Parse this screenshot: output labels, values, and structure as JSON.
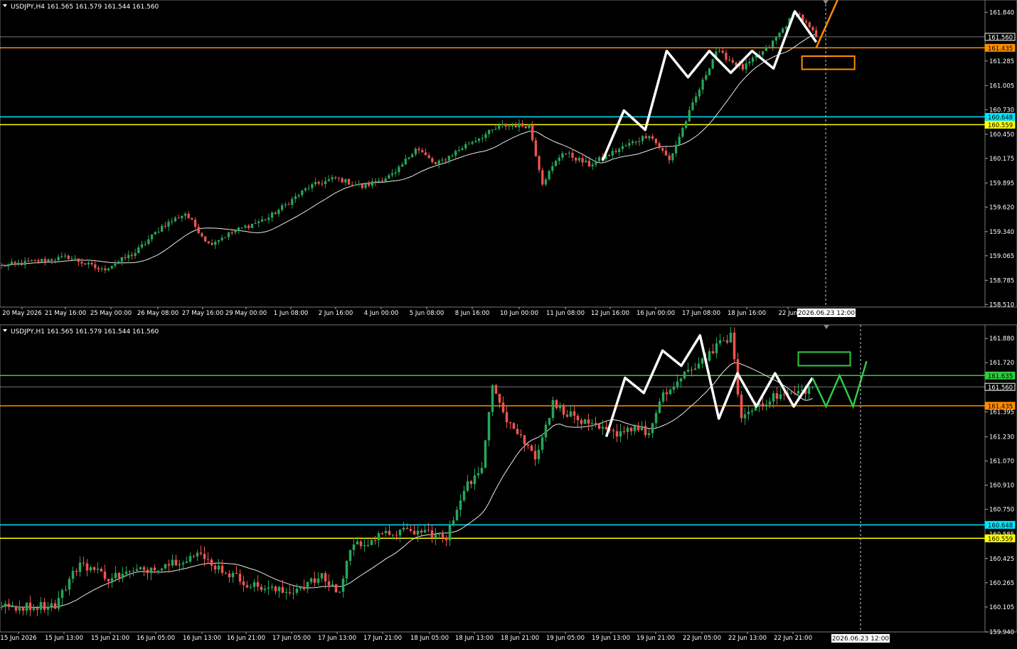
{
  "panels": [
    {
      "id": "h4",
      "header": "USDJPY,H4  161.565 161.579 161.544 161.560",
      "ticks": [
        "161.840",
        "161.285",
        "161.005",
        "160.730",
        "160.450",
        "160.175",
        "159.895",
        "159.620",
        "159.340",
        "159.065",
        "158.785",
        "158.510"
      ],
      "price_labels": [
        {
          "text": "161.560",
          "bg": "#000000",
          "fg": "#ffffff"
        },
        {
          "text": "161.435",
          "bg": "#ff8c00",
          "fg": "#000000"
        },
        {
          "text": "160.648",
          "bg": "#00e5ff",
          "fg": "#000000"
        },
        {
          "text": "160.559",
          "bg": "#ffff00",
          "fg": "#000000"
        }
      ],
      "time_labels": [
        "20 May 2026",
        "21 May 16:00",
        "25 May 00:00",
        "26 May 08:00",
        "27 May 16:00",
        "29 May 00:00",
        "1 Jun 08:00",
        "2 Jun 16:00",
        "4 Jun 00:00",
        "5 Jun 08:00",
        "8 Jun 16:00",
        "10 Jun 00:00",
        "11 Jun 08:00",
        "12 Jun 16:00",
        "16 Jun 00:00",
        "17 Jun 08:00",
        "18 Jun 16:00",
        "22 Jun"
      ],
      "cursor_label": "2026.06.23 12:00"
    },
    {
      "id": "h1",
      "header": "USDJPY,H1  161.565 161.579 161.544 161.560",
      "ticks": [
        "161.880",
        "161.720",
        "161.395",
        "161.230",
        "161.070",
        "160.910",
        "160.750",
        "160.425",
        "160.265",
        "160.105",
        "159.940"
      ],
      "price_labels": [
        {
          "text": "161.635",
          "bg": "#2ecc40",
          "fg": "#000000"
        },
        {
          "text": "161.560",
          "bg": "#000000",
          "fg": "#ffffff"
        },
        {
          "text": "161.435",
          "bg": "#ff8c00",
          "fg": "#000000"
        },
        {
          "text": "160.648",
          "bg": "#00e5ff",
          "fg": "#000000"
        },
        {
          "text": "160.559",
          "bg": "#ffff00",
          "fg": "#000000"
        }
      ],
      "partial_tick": "160.585",
      "time_labels": [
        "15 Jun 2026",
        "15 Jun 13:00",
        "15 Jun 21:00",
        "16 Jun 05:00",
        "16 Jun 13:00",
        "16 Jun 21:00",
        "17 Jun 05:00",
        "17 Jun 13:00",
        "17 Jun 21:00",
        "18 Jun 05:00",
        "18 Jun 13:00",
        "18 Jun 21:00",
        "19 Jun 05:00",
        "19 Jun 13:00",
        "19 Jun 21:00",
        "22 Jun 05:00",
        "22 Jun 13:00",
        "22 Jun 21:00"
      ],
      "cursor_label": "2026.06.23 12:00"
    }
  ],
  "colors": {
    "bull": "#26a65b",
    "bear": "#ef5350",
    "ma": "#e8e8e8",
    "orange": "#ff8c00",
    "cyan": "#00e5ff",
    "yellow": "#ffff00",
    "green": "#2ecc40",
    "grid": "#555555",
    "text": "#ffffff"
  },
  "chart_data": [
    {
      "type": "candlestick",
      "symbol": "USDJPY",
      "timeframe": "H4",
      "ylim": [
        158.48,
        161.98
      ],
      "x_start": "20 May 2026",
      "x_end": "23 Jun 2026",
      "current_price": 161.56,
      "levels": [
        {
          "price": 161.435,
          "color": "orange"
        },
        {
          "price": 160.648,
          "color": "cyan"
        },
        {
          "price": 160.559,
          "color": "yellow"
        }
      ],
      "anchors": [
        {
          "i": 0,
          "p": 158.95
        },
        {
          "i": 10,
          "p": 159.0
        },
        {
          "i": 20,
          "p": 159.05
        },
        {
          "i": 30,
          "p": 158.9
        },
        {
          "i": 40,
          "p": 159.1
        },
        {
          "i": 48,
          "p": 159.4
        },
        {
          "i": 55,
          "p": 159.55
        },
        {
          "i": 62,
          "p": 159.2
        },
        {
          "i": 70,
          "p": 159.35
        },
        {
          "i": 80,
          "p": 159.5
        },
        {
          "i": 92,
          "p": 159.85
        },
        {
          "i": 100,
          "p": 159.95
        },
        {
          "i": 108,
          "p": 159.85
        },
        {
          "i": 118,
          "p": 160.0
        },
        {
          "i": 124,
          "p": 160.3
        },
        {
          "i": 130,
          "p": 160.1
        },
        {
          "i": 140,
          "p": 160.35
        },
        {
          "i": 150,
          "p": 160.55
        },
        {
          "i": 158,
          "p": 160.55
        },
        {
          "i": 162,
          "p": 159.9
        },
        {
          "i": 168,
          "p": 160.25
        },
        {
          "i": 176,
          "p": 160.1
        },
        {
          "i": 186,
          "p": 160.3
        },
        {
          "i": 194,
          "p": 160.45
        },
        {
          "i": 200,
          "p": 160.15
        },
        {
          "i": 206,
          "p": 160.7
        },
        {
          "i": 214,
          "p": 161.4
        },
        {
          "i": 222,
          "p": 161.2
        },
        {
          "i": 230,
          "p": 161.45
        },
        {
          "i": 238,
          "p": 161.85
        },
        {
          "i": 244,
          "p": 161.56
        }
      ],
      "zigzag": [
        [
          160.15,
          "17 Jun 00:00"
        ],
        [
          160.72,
          "17 Jun 08:00"
        ],
        [
          160.5,
          "17 Jun 16:00"
        ],
        [
          161.4,
          "18 Jun 08:00"
        ],
        [
          161.1,
          "18 Jun 16:00"
        ],
        [
          161.4,
          "19 Jun 00:00"
        ],
        [
          161.15,
          "19 Jun 08:00"
        ],
        [
          161.4,
          "19 Jun 16:00"
        ],
        [
          161.2,
          "22 Jun 00:00"
        ],
        [
          161.85,
          "22 Jun 12:00"
        ],
        [
          161.5,
          "23 Jun 00:00"
        ]
      ],
      "projection": "up from 161.435 above 161.98",
      "box": {
        "from": 161.19,
        "to": 161.34,
        "color": "orange"
      }
    },
    {
      "type": "candlestick",
      "symbol": "USDJPY",
      "timeframe": "H1",
      "ylim": [
        159.94,
        161.97
      ],
      "x_start": "15 Jun 2026",
      "x_end": "23 Jun 2026",
      "current_price": 161.56,
      "levels": [
        {
          "price": 161.635,
          "color": "green"
        },
        {
          "price": 161.435,
          "color": "orange"
        },
        {
          "price": 160.648,
          "color": "cyan"
        },
        {
          "price": 160.559,
          "color": "yellow"
        }
      ],
      "anchors": [
        {
          "i": 0,
          "p": 160.1
        },
        {
          "i": 15,
          "p": 160.12
        },
        {
          "i": 22,
          "p": 160.4
        },
        {
          "i": 30,
          "p": 160.3
        },
        {
          "i": 40,
          "p": 160.35
        },
        {
          "i": 55,
          "p": 160.45
        },
        {
          "i": 62,
          "p": 160.35
        },
        {
          "i": 70,
          "p": 160.25
        },
        {
          "i": 80,
          "p": 160.2
        },
        {
          "i": 90,
          "p": 160.3
        },
        {
          "i": 95,
          "p": 160.2
        },
        {
          "i": 98,
          "p": 160.5
        },
        {
          "i": 110,
          "p": 160.6
        },
        {
          "i": 120,
          "p": 160.6
        },
        {
          "i": 125,
          "p": 160.55
        },
        {
          "i": 130,
          "p": 160.9
        },
        {
          "i": 135,
          "p": 161.0
        },
        {
          "i": 138,
          "p": 161.6
        },
        {
          "i": 142,
          "p": 161.35
        },
        {
          "i": 150,
          "p": 161.1
        },
        {
          "i": 155,
          "p": 161.45
        },
        {
          "i": 165,
          "p": 161.3
        },
        {
          "i": 172,
          "p": 161.25
        },
        {
          "i": 178,
          "p": 161.3
        },
        {
          "i": 182,
          "p": 161.25
        },
        {
          "i": 186,
          "p": 161.5
        },
        {
          "i": 195,
          "p": 161.7
        },
        {
          "i": 205,
          "p": 161.9
        },
        {
          "i": 208,
          "p": 161.35
        },
        {
          "i": 213,
          "p": 161.45
        },
        {
          "i": 218,
          "p": 161.5
        },
        {
          "i": 224,
          "p": 161.52
        },
        {
          "i": 228,
          "p": 161.56
        }
      ],
      "zigzag": [
        [
          161.23,
          "19 Jun 21:00"
        ],
        [
          161.62,
          "22 Jun 01:00"
        ],
        [
          161.52,
          "22 Jun 03:00"
        ],
        [
          161.8,
          "22 Jun 09:00"
        ],
        [
          161.7,
          "22 Jun 11:00"
        ],
        [
          161.9,
          "22 Jun 13:00"
        ],
        [
          161.35,
          "22 Jun 14:00"
        ],
        [
          161.65,
          "22 Jun 17:00"
        ],
        [
          161.43,
          "22 Jun 19:00"
        ],
        [
          161.65,
          "22 Jun 22:00"
        ],
        [
          161.43,
          "23 Jun 00:00"
        ],
        [
          161.62,
          "23 Jun 02:00"
        ]
      ],
      "projection": [
        [
          161.62,
          "23 Jun 02:00"
        ],
        [
          161.43,
          "23 Jun 05:00"
        ],
        [
          161.635,
          "23 Jun 08:00"
        ],
        [
          161.43,
          "23 Jun 11:00"
        ],
        [
          161.73,
          "23 Jun 14:00"
        ]
      ],
      "box": {
        "from": 161.7,
        "to": 161.79,
        "color": "green"
      }
    }
  ]
}
